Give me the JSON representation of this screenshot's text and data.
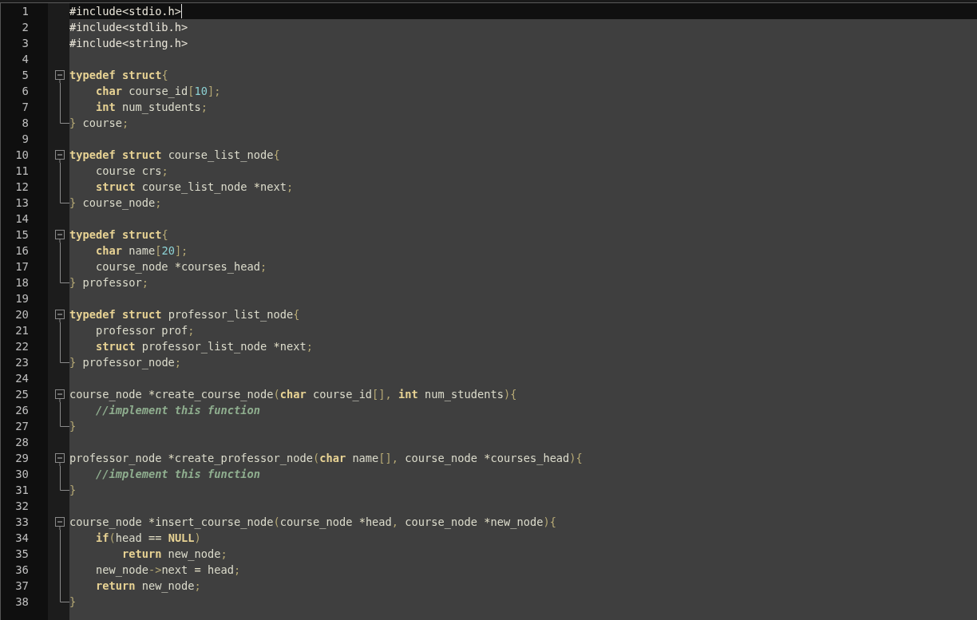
{
  "editor": {
    "lines": [
      {
        "number": "1",
        "current": true,
        "tokens": [
          {
            "kind": "pp",
            "text": "#include<stdio.h>"
          }
        ]
      },
      {
        "number": "2",
        "current": false,
        "tokens": [
          {
            "kind": "pp",
            "text": "#include<stdlib.h>"
          }
        ]
      },
      {
        "number": "3",
        "current": false,
        "tokens": [
          {
            "kind": "pp",
            "text": "#include<string.h>"
          }
        ]
      },
      {
        "number": "4",
        "current": false
      },
      {
        "number": "5",
        "current": false,
        "fold_start": true,
        "tokens": [
          {
            "kind": "kw",
            "text": "typedef "
          },
          {
            "kind": "kw",
            "text": "struct"
          },
          {
            "kind": "punct",
            "text": "{"
          }
        ]
      },
      {
        "number": "6",
        "current": false,
        "tokens": [
          {
            "kind": "kw",
            "text": "    char"
          },
          {
            "kind": "plain",
            "text": " course_id"
          },
          {
            "kind": "punct",
            "text": "["
          },
          {
            "kind": "num",
            "text": "10"
          },
          {
            "kind": "punct",
            "text": "];"
          }
        ]
      },
      {
        "number": "7",
        "current": false,
        "tokens": [
          {
            "kind": "kw",
            "text": "    int"
          },
          {
            "kind": "plain",
            "text": " num_students"
          },
          {
            "kind": "punct",
            "text": ";"
          }
        ]
      },
      {
        "number": "8",
        "current": false,
        "fold_end": true,
        "tokens": [
          {
            "kind": "punct",
            "text": "}"
          },
          {
            "kind": "plain",
            "text": " course"
          },
          {
            "kind": "punct",
            "text": ";"
          }
        ]
      },
      {
        "number": "9",
        "current": false
      },
      {
        "number": "10",
        "current": false,
        "fold_start": true,
        "tokens": [
          {
            "kind": "kw",
            "text": "typedef "
          },
          {
            "kind": "kw",
            "text": "struct"
          },
          {
            "kind": "plain",
            "text": " course_list_node"
          },
          {
            "kind": "punct",
            "text": "{"
          }
        ]
      },
      {
        "number": "11",
        "current": false,
        "tokens": [
          {
            "kind": "plain",
            "text": "    course crs"
          },
          {
            "kind": "punct",
            "text": ";"
          }
        ]
      },
      {
        "number": "12",
        "current": false,
        "tokens": [
          {
            "kind": "kw",
            "text": "    struct"
          },
          {
            "kind": "plain",
            "text": " course_list_node "
          },
          {
            "kind": "op",
            "text": "*"
          },
          {
            "kind": "plain",
            "text": "next"
          },
          {
            "kind": "punct",
            "text": ";"
          }
        ]
      },
      {
        "number": "13",
        "current": false,
        "fold_end": true,
        "tokens": [
          {
            "kind": "punct",
            "text": "}"
          },
          {
            "kind": "plain",
            "text": " course_node"
          },
          {
            "kind": "punct",
            "text": ";"
          }
        ]
      },
      {
        "number": "14",
        "current": false
      },
      {
        "number": "15",
        "current": false,
        "fold_start": true,
        "tokens": [
          {
            "kind": "kw",
            "text": "typedef "
          },
          {
            "kind": "kw",
            "text": "struct"
          },
          {
            "kind": "punct",
            "text": "{"
          }
        ]
      },
      {
        "number": "16",
        "current": false,
        "tokens": [
          {
            "kind": "kw",
            "text": "    char"
          },
          {
            "kind": "plain",
            "text": " name"
          },
          {
            "kind": "punct",
            "text": "["
          },
          {
            "kind": "num",
            "text": "20"
          },
          {
            "kind": "punct",
            "text": "];"
          }
        ]
      },
      {
        "number": "17",
        "current": false,
        "tokens": [
          {
            "kind": "plain",
            "text": "    course_node "
          },
          {
            "kind": "op",
            "text": "*"
          },
          {
            "kind": "plain",
            "text": "courses_head"
          },
          {
            "kind": "punct",
            "text": ";"
          }
        ]
      },
      {
        "number": "18",
        "current": false,
        "fold_end": true,
        "tokens": [
          {
            "kind": "punct",
            "text": "}"
          },
          {
            "kind": "plain",
            "text": " professor"
          },
          {
            "kind": "punct",
            "text": ";"
          }
        ]
      },
      {
        "number": "19",
        "current": false
      },
      {
        "number": "20",
        "current": false,
        "fold_start": true,
        "tokens": [
          {
            "kind": "kw",
            "text": "typedef "
          },
          {
            "kind": "kw",
            "text": "struct"
          },
          {
            "kind": "plain",
            "text": " professor_list_node"
          },
          {
            "kind": "punct",
            "text": "{"
          }
        ]
      },
      {
        "number": "21",
        "current": false,
        "tokens": [
          {
            "kind": "plain",
            "text": "    professor prof"
          },
          {
            "kind": "punct",
            "text": ";"
          }
        ]
      },
      {
        "number": "22",
        "current": false,
        "tokens": [
          {
            "kind": "kw",
            "text": "    struct"
          },
          {
            "kind": "plain",
            "text": " professor_list_node "
          },
          {
            "kind": "op",
            "text": "*"
          },
          {
            "kind": "plain",
            "text": "next"
          },
          {
            "kind": "punct",
            "text": ";"
          }
        ]
      },
      {
        "number": "23",
        "current": false,
        "fold_end": true,
        "tokens": [
          {
            "kind": "punct",
            "text": "}"
          },
          {
            "kind": "plain",
            "text": " professor_node"
          },
          {
            "kind": "punct",
            "text": ";"
          }
        ]
      },
      {
        "number": "24",
        "current": false
      },
      {
        "number": "25",
        "current": false,
        "fold_start": true,
        "tokens": [
          {
            "kind": "plain",
            "text": "course_node "
          },
          {
            "kind": "op",
            "text": "*"
          },
          {
            "kind": "plain",
            "text": "create_course_node"
          },
          {
            "kind": "punct",
            "text": "("
          },
          {
            "kind": "kw",
            "text": "char"
          },
          {
            "kind": "plain",
            "text": " course_id"
          },
          {
            "kind": "punct",
            "text": "[], "
          },
          {
            "kind": "kw",
            "text": "int"
          },
          {
            "kind": "plain",
            "text": " num_students"
          },
          {
            "kind": "punct",
            "text": "){"
          }
        ]
      },
      {
        "number": "26",
        "current": false,
        "tokens": [
          {
            "kind": "comment",
            "text": "    //implement this function"
          }
        ]
      },
      {
        "number": "27",
        "current": false,
        "fold_end": true,
        "tokens": [
          {
            "kind": "punct",
            "text": "}"
          }
        ]
      },
      {
        "number": "28",
        "current": false
      },
      {
        "number": "29",
        "current": false,
        "fold_start": true,
        "tokens": [
          {
            "kind": "plain",
            "text": "professor_node "
          },
          {
            "kind": "op",
            "text": "*"
          },
          {
            "kind": "plain",
            "text": "create_professor_node"
          },
          {
            "kind": "punct",
            "text": "("
          },
          {
            "kind": "kw",
            "text": "char"
          },
          {
            "kind": "plain",
            "text": " name"
          },
          {
            "kind": "punct",
            "text": "[],"
          },
          {
            "kind": "plain",
            "text": " course_node "
          },
          {
            "kind": "op",
            "text": "*"
          },
          {
            "kind": "plain",
            "text": "courses_head"
          },
          {
            "kind": "punct",
            "text": "){"
          }
        ]
      },
      {
        "number": "30",
        "current": false,
        "tokens": [
          {
            "kind": "comment",
            "text": "    //implement this function"
          }
        ]
      },
      {
        "number": "31",
        "current": false,
        "fold_end": true,
        "tokens": [
          {
            "kind": "punct",
            "text": "}"
          }
        ]
      },
      {
        "number": "32",
        "current": false
      },
      {
        "number": "33",
        "current": false,
        "fold_start": true,
        "tokens": [
          {
            "kind": "plain",
            "text": "course_node "
          },
          {
            "kind": "op",
            "text": "*"
          },
          {
            "kind": "plain",
            "text": "insert_course_node"
          },
          {
            "kind": "punct",
            "text": "("
          },
          {
            "kind": "plain",
            "text": "course_node "
          },
          {
            "kind": "op",
            "text": "*"
          },
          {
            "kind": "plain",
            "text": "head"
          },
          {
            "kind": "punct",
            "text": ","
          },
          {
            "kind": "plain",
            "text": " course_node "
          },
          {
            "kind": "op",
            "text": "*"
          },
          {
            "kind": "plain",
            "text": "new_node"
          },
          {
            "kind": "punct",
            "text": "){"
          }
        ]
      },
      {
        "number": "34",
        "current": false,
        "tokens": [
          {
            "kind": "kw",
            "text": "    if"
          },
          {
            "kind": "punct",
            "text": "("
          },
          {
            "kind": "plain",
            "text": "head "
          },
          {
            "kind": "op",
            "text": "== "
          },
          {
            "kind": "kw",
            "text": "NULL"
          },
          {
            "kind": "punct",
            "text": ")"
          }
        ]
      },
      {
        "number": "35",
        "current": false,
        "tokens": [
          {
            "kind": "kw",
            "text": "        return"
          },
          {
            "kind": "plain",
            "text": " new_node"
          },
          {
            "kind": "punct",
            "text": ";"
          }
        ]
      },
      {
        "number": "36",
        "current": false,
        "tokens": [
          {
            "kind": "plain",
            "text": "    new_node"
          },
          {
            "kind": "punct",
            "text": "->"
          },
          {
            "kind": "plain",
            "text": "next "
          },
          {
            "kind": "op",
            "text": "="
          },
          {
            "kind": "plain",
            "text": " head"
          },
          {
            "kind": "punct",
            "text": ";"
          }
        ]
      },
      {
        "number": "37",
        "current": false,
        "tokens": [
          {
            "kind": "kw",
            "text": "    return"
          },
          {
            "kind": "plain",
            "text": " new_node"
          },
          {
            "kind": "punct",
            "text": ";"
          }
        ]
      },
      {
        "number": "38",
        "current": false,
        "fold_end": true,
        "tokens": [
          {
            "kind": "punct",
            "text": "}"
          }
        ]
      }
    ]
  }
}
